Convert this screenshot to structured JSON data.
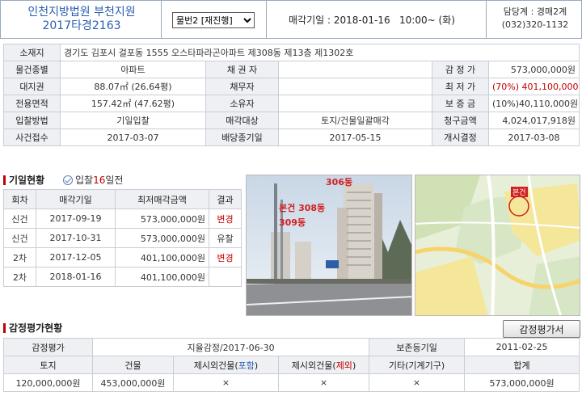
{
  "header": {
    "court": "인천지방법원 부천지원",
    "case_no": "2017타경2163",
    "item_select": "물번2 [재진행]",
    "auction_date_label": "매각기일",
    "auction_date_value": ": 2018-01-16   10:00~ (화)",
    "contact_dept": "담당계 : 경매2계",
    "contact_phone": "(032)320-1132"
  },
  "info": {
    "location_label": "소재지",
    "location_value": "경기도 김포시 걸포동 1555 오스타파라곤아파트 제308동 제13층 제1302호",
    "rows": [
      [
        "물건종별",
        "아파트",
        "채 권 자",
        "",
        "감 정 가",
        "573,000,000원"
      ],
      [
        "대지권",
        "88.07㎡ (26.64평)",
        "채무자",
        "",
        "최 저 가",
        "(70%) 401,100,000원"
      ],
      [
        "전용면적",
        "157.42㎡ (47.62평)",
        "소유자",
        "",
        "보 증 금",
        "(10%)40,110,000원"
      ],
      [
        "입찰방법",
        "기일입찰",
        "매각대상",
        "토지/건물일괄매각",
        "청구금액",
        "4,024,017,918원"
      ],
      [
        "사건접수",
        "2017-03-07",
        "배당종기일",
        "2017-05-15",
        "개시결정",
        "2017-03-08"
      ]
    ]
  },
  "history": {
    "title": "기일현황",
    "tender_prefix": "입찰",
    "tender_days": "16",
    "tender_suffix": "일전",
    "headers": [
      "회차",
      "매각기일",
      "최저매각금액",
      "결과"
    ],
    "rows": [
      [
        "신건",
        "2017-09-19",
        "573,000,000원",
        "변경"
      ],
      [
        "신건",
        "2017-10-31",
        "573,000,000원",
        "유찰"
      ],
      [
        "2차",
        "2017-12-05",
        "401,100,000원",
        "변경"
      ],
      [
        "2차",
        "2018-01-16",
        "401,100,000원",
        ""
      ]
    ]
  },
  "photo": {
    "label_306": "306동",
    "label_308": "본건 308동",
    "label_309": "309동"
  },
  "map": {
    "marker": "본건"
  },
  "appraisal": {
    "title": "감정평가현황",
    "button": "감정평가서",
    "row1": [
      "감정평가",
      "지율감정/2017-06-30",
      "보존등기일",
      "2011-02-25"
    ],
    "headers": [
      "토지",
      "건물",
      "제시외건물(포함)",
      "제시외건물(제외)",
      "기타(기계기구)",
      "합계"
    ],
    "values": [
      "120,000,000원",
      "453,000,000원",
      "×",
      "×",
      "×",
      "573,000,000원"
    ]
  },
  "colors": {
    "accent_blue": "#2a5db0",
    "accent_red": "#c00000",
    "label_bg": "#eef0f3"
  }
}
